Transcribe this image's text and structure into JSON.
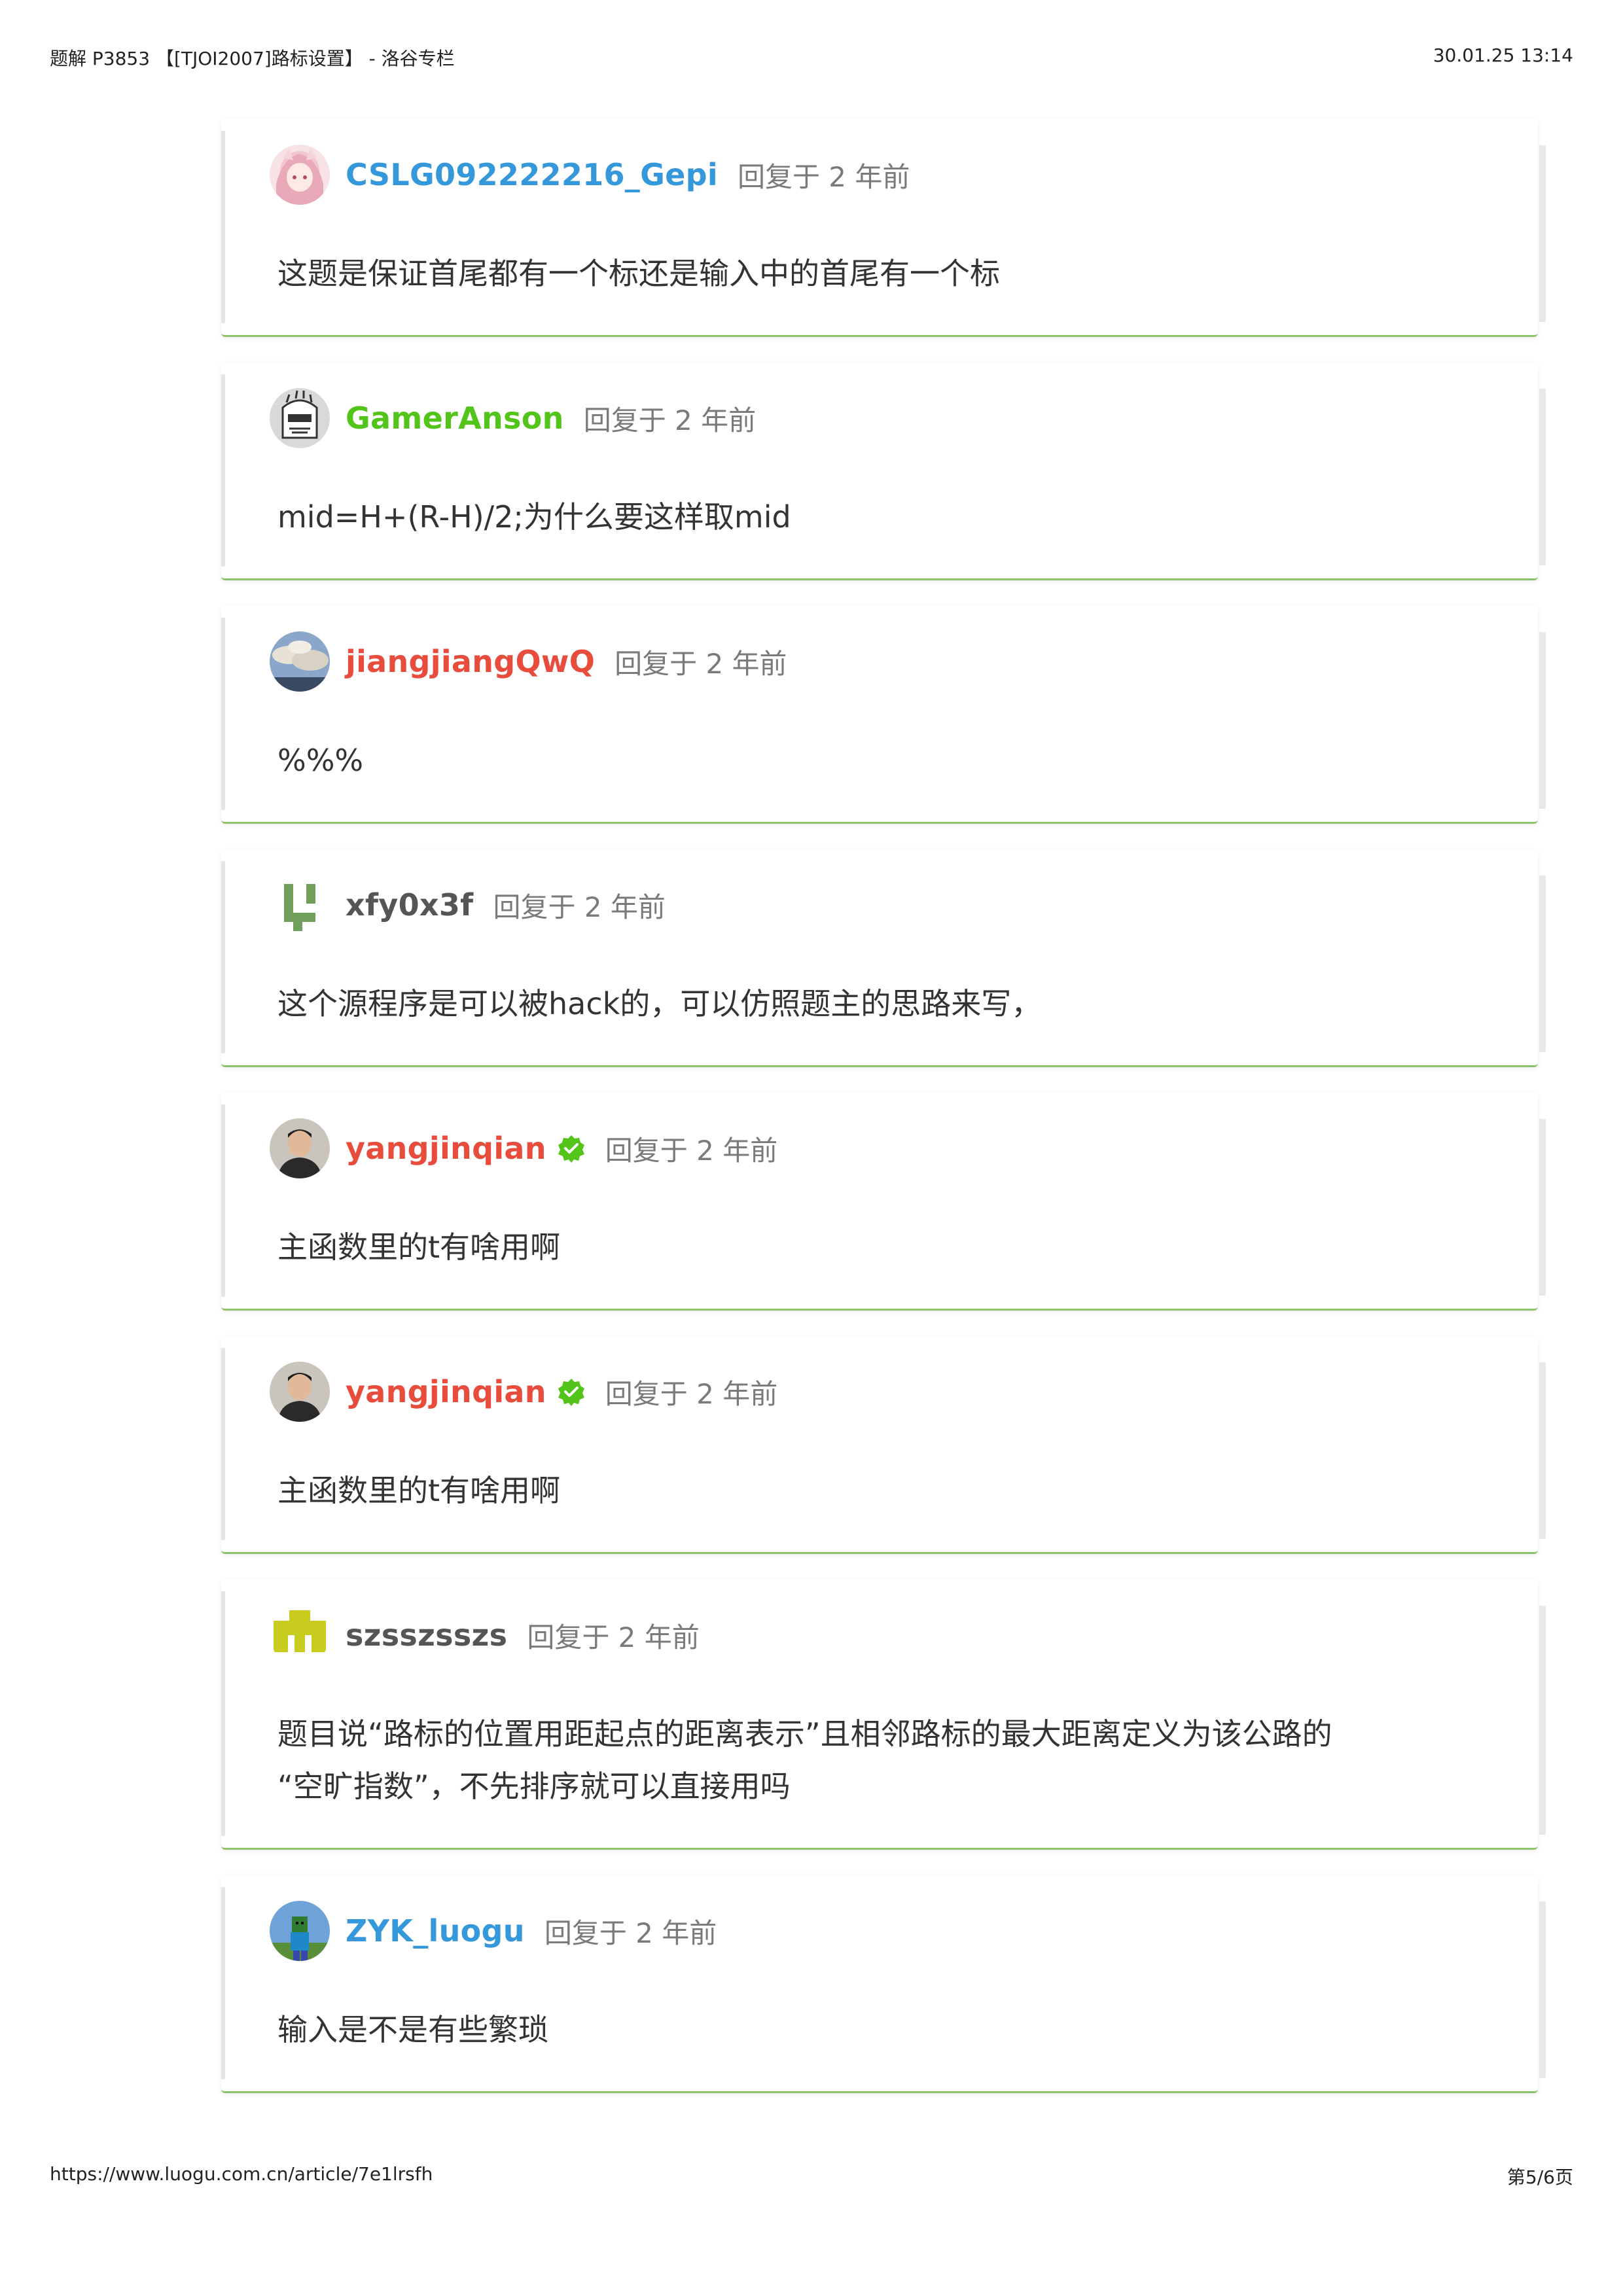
{
  "header": {
    "title": "题解 P3853 【[TJOI2007]路标设置】 - 洛谷专栏",
    "datetime": "30.01.25 13:14"
  },
  "footer": {
    "url": "https://www.luogu.com.cn/article/7e1lrsfh",
    "page": "第5/6页"
  },
  "colors": {
    "name_blue": "#3498db",
    "name_green": "#52c41a",
    "name_red": "#e74c3c",
    "name_gray": "#555555",
    "card_border": "#8cc46b",
    "verified_green": "#52c41a"
  },
  "comments": [
    {
      "user": "CSLG092222216_Gepi",
      "reply": "回复于 2 年前",
      "text": [
        "这题是保证首尾都有一个标还是输入中的首尾有一个标"
      ],
      "name_color": "blue",
      "verified": false,
      "avatar": "anime-girl-avatar"
    },
    {
      "user": "GamerAnson",
      "reply": "回复于 2 年前",
      "text": [
        "mid=H+(R-H)/2;为什么要这样取mid"
      ],
      "name_color": "green",
      "verified": false,
      "avatar": "knight-helmet-avatar"
    },
    {
      "user": "jiangjiangQwQ",
      "reply": "回复于 2 年前",
      "text": [
        "%%%"
      ],
      "name_color": "red",
      "verified": false,
      "avatar": "sky-clouds-avatar"
    },
    {
      "user": "xfy0x3f",
      "reply": "回复于 2 年前",
      "text": [
        "这个源程序是可以被hack的，可以仿照题主的思路来写，"
      ],
      "name_color": "gray",
      "verified": false,
      "avatar": "identicon-green-avatar"
    },
    {
      "user": "yangjinqian",
      "reply": "回复于 2 年前",
      "text": [
        "主函数里的t有啥用啊"
      ],
      "name_color": "red",
      "verified": true,
      "avatar": "person-photo-avatar"
    },
    {
      "user": "yangjinqian",
      "reply": "回复于 2 年前",
      "text": [
        "主函数里的t有啥用啊"
      ],
      "name_color": "red",
      "verified": true,
      "avatar": "person-photo-avatar"
    },
    {
      "user": "szsszsszs",
      "reply": "回复于 2 年前",
      "text": [
        "题目说“路标的位置用距起点的距离表示”且相邻路标的最大距离定义为该公路的",
        "“空旷指数”，不先排序就可以直接用吗"
      ],
      "name_color": "gray",
      "verified": false,
      "avatar": "identicon-yellow-avatar"
    },
    {
      "user": "ZYK_luogu",
      "reply": "回复于 2 年前",
      "text": [
        "输入是不是有些繁琐"
      ],
      "name_color": "blue",
      "verified": false,
      "avatar": "minecraft-avatar"
    }
  ]
}
